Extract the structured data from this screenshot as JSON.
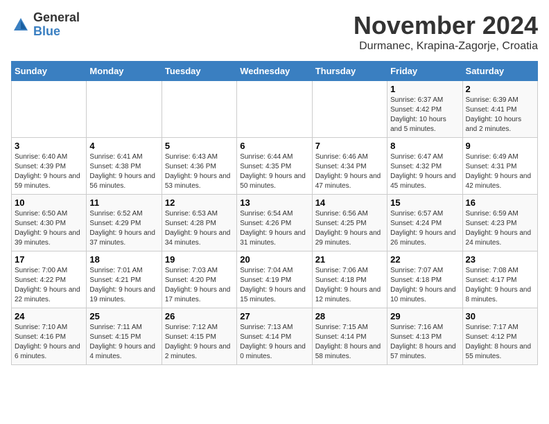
{
  "header": {
    "logo_general": "General",
    "logo_blue": "Blue",
    "month_title": "November 2024",
    "location": "Durmanec, Krapina-Zagorje, Croatia"
  },
  "columns": [
    "Sunday",
    "Monday",
    "Tuesday",
    "Wednesday",
    "Thursday",
    "Friday",
    "Saturday"
  ],
  "weeks": [
    [
      {
        "day": "",
        "info": ""
      },
      {
        "day": "",
        "info": ""
      },
      {
        "day": "",
        "info": ""
      },
      {
        "day": "",
        "info": ""
      },
      {
        "day": "",
        "info": ""
      },
      {
        "day": "1",
        "info": "Sunrise: 6:37 AM\nSunset: 4:42 PM\nDaylight: 10 hours\nand 5 minutes."
      },
      {
        "day": "2",
        "info": "Sunrise: 6:39 AM\nSunset: 4:41 PM\nDaylight: 10 hours\nand 2 minutes."
      }
    ],
    [
      {
        "day": "3",
        "info": "Sunrise: 6:40 AM\nSunset: 4:39 PM\nDaylight: 9 hours\nand 59 minutes."
      },
      {
        "day": "4",
        "info": "Sunrise: 6:41 AM\nSunset: 4:38 PM\nDaylight: 9 hours\nand 56 minutes."
      },
      {
        "day": "5",
        "info": "Sunrise: 6:43 AM\nSunset: 4:36 PM\nDaylight: 9 hours\nand 53 minutes."
      },
      {
        "day": "6",
        "info": "Sunrise: 6:44 AM\nSunset: 4:35 PM\nDaylight: 9 hours\nand 50 minutes."
      },
      {
        "day": "7",
        "info": "Sunrise: 6:46 AM\nSunset: 4:34 PM\nDaylight: 9 hours\nand 47 minutes."
      },
      {
        "day": "8",
        "info": "Sunrise: 6:47 AM\nSunset: 4:32 PM\nDaylight: 9 hours\nand 45 minutes."
      },
      {
        "day": "9",
        "info": "Sunrise: 6:49 AM\nSunset: 4:31 PM\nDaylight: 9 hours\nand 42 minutes."
      }
    ],
    [
      {
        "day": "10",
        "info": "Sunrise: 6:50 AM\nSunset: 4:30 PM\nDaylight: 9 hours\nand 39 minutes."
      },
      {
        "day": "11",
        "info": "Sunrise: 6:52 AM\nSunset: 4:29 PM\nDaylight: 9 hours\nand 37 minutes."
      },
      {
        "day": "12",
        "info": "Sunrise: 6:53 AM\nSunset: 4:28 PM\nDaylight: 9 hours\nand 34 minutes."
      },
      {
        "day": "13",
        "info": "Sunrise: 6:54 AM\nSunset: 4:26 PM\nDaylight: 9 hours\nand 31 minutes."
      },
      {
        "day": "14",
        "info": "Sunrise: 6:56 AM\nSunset: 4:25 PM\nDaylight: 9 hours\nand 29 minutes."
      },
      {
        "day": "15",
        "info": "Sunrise: 6:57 AM\nSunset: 4:24 PM\nDaylight: 9 hours\nand 26 minutes."
      },
      {
        "day": "16",
        "info": "Sunrise: 6:59 AM\nSunset: 4:23 PM\nDaylight: 9 hours\nand 24 minutes."
      }
    ],
    [
      {
        "day": "17",
        "info": "Sunrise: 7:00 AM\nSunset: 4:22 PM\nDaylight: 9 hours\nand 22 minutes."
      },
      {
        "day": "18",
        "info": "Sunrise: 7:01 AM\nSunset: 4:21 PM\nDaylight: 9 hours\nand 19 minutes."
      },
      {
        "day": "19",
        "info": "Sunrise: 7:03 AM\nSunset: 4:20 PM\nDaylight: 9 hours\nand 17 minutes."
      },
      {
        "day": "20",
        "info": "Sunrise: 7:04 AM\nSunset: 4:19 PM\nDaylight: 9 hours\nand 15 minutes."
      },
      {
        "day": "21",
        "info": "Sunrise: 7:06 AM\nSunset: 4:18 PM\nDaylight: 9 hours\nand 12 minutes."
      },
      {
        "day": "22",
        "info": "Sunrise: 7:07 AM\nSunset: 4:18 PM\nDaylight: 9 hours\nand 10 minutes."
      },
      {
        "day": "23",
        "info": "Sunrise: 7:08 AM\nSunset: 4:17 PM\nDaylight: 9 hours\nand 8 minutes."
      }
    ],
    [
      {
        "day": "24",
        "info": "Sunrise: 7:10 AM\nSunset: 4:16 PM\nDaylight: 9 hours\nand 6 minutes."
      },
      {
        "day": "25",
        "info": "Sunrise: 7:11 AM\nSunset: 4:15 PM\nDaylight: 9 hours\nand 4 minutes."
      },
      {
        "day": "26",
        "info": "Sunrise: 7:12 AM\nSunset: 4:15 PM\nDaylight: 9 hours\nand 2 minutes."
      },
      {
        "day": "27",
        "info": "Sunrise: 7:13 AM\nSunset: 4:14 PM\nDaylight: 9 hours\nand 0 minutes."
      },
      {
        "day": "28",
        "info": "Sunrise: 7:15 AM\nSunset: 4:14 PM\nDaylight: 8 hours\nand 58 minutes."
      },
      {
        "day": "29",
        "info": "Sunrise: 7:16 AM\nSunset: 4:13 PM\nDaylight: 8 hours\nand 57 minutes."
      },
      {
        "day": "30",
        "info": "Sunrise: 7:17 AM\nSunset: 4:12 PM\nDaylight: 8 hours\nand 55 minutes."
      }
    ]
  ]
}
